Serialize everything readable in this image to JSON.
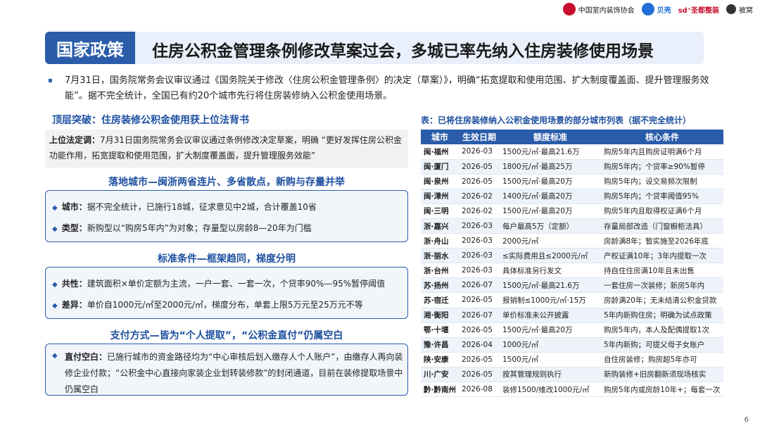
{
  "logos": [
    "中国室内装饰协会",
    "贝壳",
    "sd⁺圣都整装",
    "被窝"
  ],
  "header": {
    "tag": "国家政策",
    "title": "住房公积金管理条例修改草案过会，多城已率先纳入住房装修使用场景"
  },
  "intro": "7月31日，国务院常务会议审议通过《国务院关于修改〈住房公积金管理条例〉的决定（草案）》，明确“拓宽提取和使用范围、扩大制度覆盖面、提升管理服务效能”。据不完全统计，全国已有约20个城市先行将住房装修纳入公积金使用场景。",
  "left": {
    "sub1": "顶层突破：住房装修公积金使用获上位法背书",
    "gray_label": "上位法定调：",
    "gray_text": "7月31日国务院常务会议审议通过条例修改决定草案，明确 “更好发挥住房公积金功能作用，拓宽提取和使用范围，扩大制度覆盖面，提升管理服务效能”",
    "sec1": "落地城市—闽浙两省连片、多省散点，新购与存量并举",
    "city_label": "城市：",
    "city_text": "据不完全统计，已施行18城，征求意见中2城，合计覆盖10省",
    "type_label": "类型：",
    "type_text": "新购型以“购房5年内”为对象；存量型以房龄8—20年为门槛",
    "sec2": "标准条件—框架趋同，梯度分明",
    "common_label": "共性：",
    "common_text": "建筑面积×单价定额为主流，一户一套、一套一次，个贷率90%—95%暂停阈值",
    "diff_label": "差异：",
    "diff_text": "单价自1000元/㎡至2000元/㎡，梯度分布，单套上限5万元至25万元不等",
    "sec3": "支付方式—皆为“个人提取”，“公积金直付”仍属空白",
    "pay_label": "直付空白：",
    "pay_text": "已施行城市的资金路径均为“中心审核后划入缴存人个人账户”，由缴存人再向装修企业付款；“公积金中心直接向家装企业划转装修款”的封闭通道，目前在装修提取场景中仍属空白"
  },
  "table": {
    "title": "表：已将住房装修纳入公积金使用场景的部分城市列表（据不完全统计）",
    "headers": [
      "城市",
      "生效日期",
      "额度标准",
      "核心条件"
    ],
    "rows": [
      [
        "闽·福州",
        "2026-03",
        "1500元/㎡·最高21.6万",
        "购房5年内且购房证明满6个月"
      ],
      [
        "闽·厦门",
        "2026-05",
        "1800元/㎡·最高25万",
        "购房5年内；个贷率≥90%暂停"
      ],
      [
        "闽·泉州",
        "2026-05",
        "1500元/㎡·最高20万",
        "购房5年内；设交易频次限制"
      ],
      [
        "闽·漳州",
        "2026-02",
        "1400元/㎡·最高20万",
        "购房5年内；个贷率阈值95%"
      ],
      [
        "闽·三明",
        "2026-02",
        "1500元/㎡·最高20万",
        "购房5年内且取得权证满6个月"
      ],
      [
        "浙·嘉兴",
        "2026-03",
        "每户最高5万（定额）",
        "存量局部改造（门窗橱柜洁具）"
      ],
      [
        "浙·舟山",
        "2026-03",
        "2000元/㎡",
        "房龄满8年；暂实施至2026年底"
      ],
      [
        "浙·丽水",
        "2026-03",
        "≤实际费用且≤2000元/㎡",
        "产权证满10年；3年内提取一次"
      ],
      [
        "浙·台州",
        "2026-03",
        "具体标准另行发文",
        "持自住住房满10年且未出售"
      ],
      [
        "苏·扬州",
        "2026-07",
        "1500元/㎡·最高21.6万",
        "一套住房一次装修；新房5年内"
      ],
      [
        "苏·宿迁",
        "2026-05",
        "报销制≤1000元/㎡·15万",
        "房龄满20年；无未结清公积金贷款"
      ],
      [
        "湘·衡阳",
        "2026-07",
        "单价标准未公开披露",
        "5年内新购住房；明确为试点政策"
      ],
      [
        "鄂·十堰",
        "2026-05",
        "1500元/㎡·最高20万",
        "购房5年内，本人及配偶提取1次"
      ],
      [
        "豫·许昌",
        "2026-04",
        "1000元/㎡",
        "5年内新购；可提父母子女账户"
      ],
      [
        "陕·安康",
        "2026-05",
        "1500元/㎡",
        "自住房装修；购房超5年亦可"
      ],
      [
        "川·广安",
        "2026-05",
        "按其管理规则执行",
        "新购装修+旧房翻新须现场核实"
      ],
      [
        "黔·黔南州",
        "2026-08",
        "装修1500/维改1000元/㎡",
        "购房5年内或房龄10年+；每套一次"
      ]
    ]
  },
  "page_number": "6"
}
